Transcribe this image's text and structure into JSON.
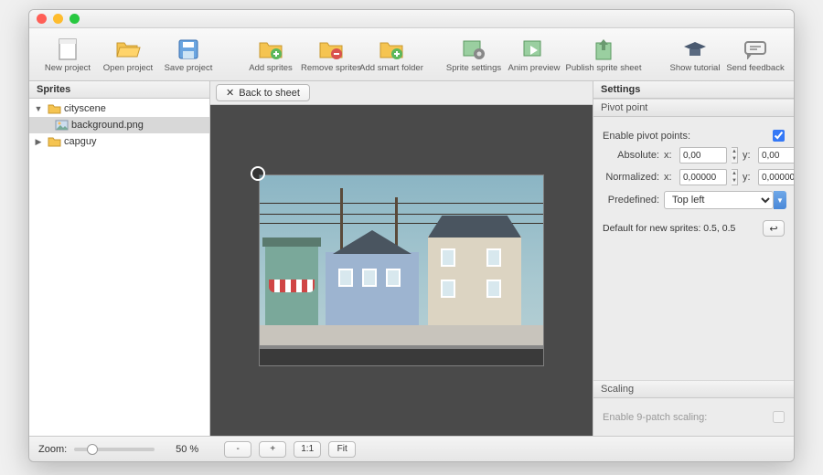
{
  "toolbar": {
    "new_project": "New project",
    "open_project": "Open project",
    "save_project": "Save project",
    "add_sprites": "Add sprites",
    "remove_sprites": "Remove sprites",
    "add_smart_folder": "Add smart folder",
    "sprite_settings": "Sprite settings",
    "anim_preview": "Anim preview",
    "publish": "Publish sprite sheet",
    "show_tutorial": "Show tutorial",
    "send_feedback": "Send feedback"
  },
  "sidebar": {
    "title": "Sprites",
    "items": [
      {
        "label": "cityscene",
        "type": "folder",
        "depth": 0,
        "expanded": true,
        "selected": false
      },
      {
        "label": "background.png",
        "type": "image",
        "depth": 1,
        "selected": true
      },
      {
        "label": "capguy",
        "type": "folder",
        "depth": 0,
        "expanded": false,
        "selected": false
      }
    ]
  },
  "center": {
    "back_label": "Back to sheet"
  },
  "settings": {
    "title": "Settings",
    "pivot": {
      "header": "Pivot point",
      "enable_label": "Enable pivot points:",
      "enabled": true,
      "absolute_label": "Absolute:",
      "normalized_label": "Normalized:",
      "predefined_label": "Predefined:",
      "x_label": "x:",
      "y_label": "y:",
      "abs_x": "0,00",
      "abs_y": "0,00",
      "norm_x": "0,00000",
      "norm_y": "0,00000",
      "predefined_value": "Top left",
      "default_label": "Default for new sprites: 0.5, 0.5",
      "reset_icon": "↩"
    },
    "scaling": {
      "header": "Scaling",
      "enable_label": "Enable 9-patch scaling:",
      "enabled": false
    }
  },
  "footer": {
    "zoom_label": "Zoom:",
    "zoom_value": "50 %",
    "minus": "-",
    "plus": "+",
    "one_to_one": "1:1",
    "fit": "Fit"
  }
}
